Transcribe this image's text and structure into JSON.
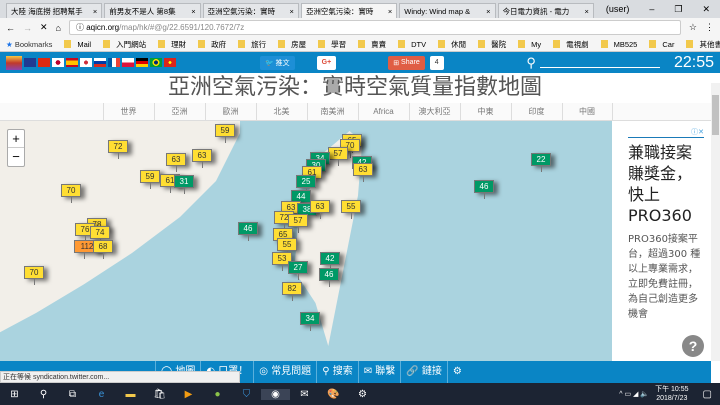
{
  "browser": {
    "tabs": [
      {
        "label": "大陸 海底撈 招聘幫手"
      },
      {
        "label": "前男友不是人 第8集"
      },
      {
        "label": "亞洲空氣污染：實時"
      },
      {
        "label": "亞洲空氣污染：實時"
      },
      {
        "label": "Windy: Wind map &"
      },
      {
        "label": "今日電力資訊 - 電力"
      }
    ],
    "user": "(user)",
    "url_host": "aqicn.org",
    "url_path": "/map/hk/#@g/22.6591/120.7672/7z",
    "bookmarks": [
      "Bookmarks",
      "Mail",
      "入門網站",
      "理財",
      "政府",
      "旅行",
      "房屋",
      "學習",
      "賣賣",
      "DTV",
      "休閒",
      "醫院",
      "My",
      "電視劇",
      "MB525",
      "Car"
    ],
    "other_bookmarks": "其他書籤"
  },
  "site": {
    "tweet": "推文",
    "gplus": "G+",
    "share": "Share",
    "share_count": "4",
    "clock": "22:55",
    "title": "亞洲空氣污染：實時空氣質量指數地圖",
    "nav": [
      "世界",
      "亞洲",
      "歐洲",
      "北美",
      "南美洲",
      "Africa",
      "澳大利亞",
      "中東",
      "印度",
      "中國"
    ],
    "zoom_in": "+",
    "zoom_out": "−",
    "markers": [
      {
        "v": "72",
        "c": "#ffde33"
      },
      {
        "v": "59",
        "c": "#ffde33"
      },
      {
        "v": "63",
        "c": "#ffde33"
      },
      {
        "v": "63",
        "c": "#ffde33"
      },
      {
        "v": "59",
        "c": "#ffde33"
      },
      {
        "v": "61",
        "c": "#ffde33"
      },
      {
        "v": "31",
        "c": "#009966"
      },
      {
        "v": "70",
        "c": "#ffde33"
      },
      {
        "v": "78",
        "c": "#ffde33"
      },
      {
        "v": "76",
        "c": "#ffde33"
      },
      {
        "v": "74",
        "c": "#ffde33"
      },
      {
        "v": "112",
        "c": "#ff9933"
      },
      {
        "v": "68",
        "c": "#ffde33"
      },
      {
        "v": "70",
        "c": "#ffde33"
      },
      {
        "v": "46",
        "c": "#009966"
      },
      {
        "v": "22",
        "c": "#009966"
      },
      {
        "v": "46",
        "c": "#009966"
      },
      {
        "v": "65",
        "c": "#ffde33"
      },
      {
        "v": "70",
        "c": "#ffde33"
      },
      {
        "v": "57",
        "c": "#ffde33"
      },
      {
        "v": "42",
        "c": "#009966"
      },
      {
        "v": "63",
        "c": "#ffde33"
      },
      {
        "v": "34",
        "c": "#009966"
      },
      {
        "v": "30",
        "c": "#009966"
      },
      {
        "v": "61",
        "c": "#ffde33"
      },
      {
        "v": "25",
        "c": "#009966"
      },
      {
        "v": "44",
        "c": "#009966"
      },
      {
        "v": "63",
        "c": "#ffde33"
      },
      {
        "v": "38",
        "c": "#009966"
      },
      {
        "v": "63",
        "c": "#ffde33"
      },
      {
        "v": "55",
        "c": "#ffde33"
      },
      {
        "v": "72",
        "c": "#ffde33"
      },
      {
        "v": "57",
        "c": "#ffde33"
      },
      {
        "v": "65",
        "c": "#ffde33"
      },
      {
        "v": "55",
        "c": "#ffde33"
      },
      {
        "v": "53",
        "c": "#ffde33"
      },
      {
        "v": "27",
        "c": "#009966"
      },
      {
        "v": "42",
        "c": "#009966"
      },
      {
        "v": "46",
        "c": "#009966"
      },
      {
        "v": "82",
        "c": "#ffde33"
      },
      {
        "v": "34",
        "c": "#009966"
      }
    ],
    "ad": {
      "headline": "兼職接案賺獎金，快上PRO360",
      "body": "PRO360接案平台，超過300 種以上專業需求，立即免費註冊，為自己創造更多機會",
      "help": "?"
    },
    "bottom_nav": [
      "地圖",
      "口罩！",
      "常見問題",
      "搜索",
      "聯繫",
      "鏈接"
    ],
    "status": "正在等候 syndication.twitter.com..."
  },
  "taskbar": {
    "time": "下午 10:55",
    "date": "2018/7/23"
  }
}
